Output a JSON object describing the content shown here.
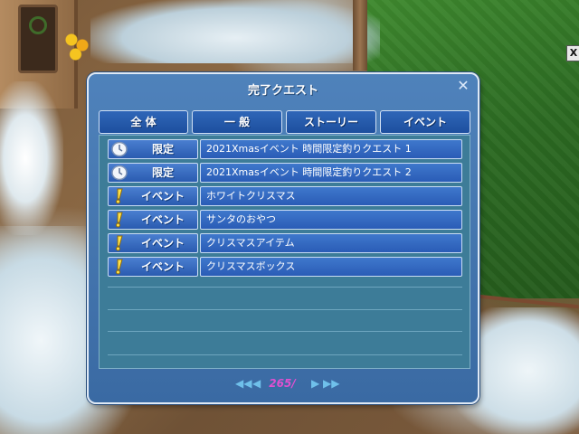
{
  "window": {
    "title": "完了クエスト",
    "close_glyph": "✕"
  },
  "side_button": {
    "glyph": "X"
  },
  "tabs": [
    {
      "label": "全 体"
    },
    {
      "label": "一 般"
    },
    {
      "label": "ストーリー"
    },
    {
      "label": "イベント"
    }
  ],
  "quests": [
    {
      "badge_icon": "clock-icon",
      "badge": "限定",
      "name": "2021Xmasイベント 時間限定釣りクエスト 1"
    },
    {
      "badge_icon": "clock-icon",
      "badge": "限定",
      "name": "2021Xmasイベント 時間限定釣りクエスト 2"
    },
    {
      "badge_icon": "exclamation-icon",
      "badge": "イベント",
      "name": "ホワイトクリスマス"
    },
    {
      "badge_icon": "exclamation-icon",
      "badge": "イベント",
      "name": "サンタのおやつ"
    },
    {
      "badge_icon": "exclamation-icon",
      "badge": "イベント",
      "name": "クリスマスアイテム"
    },
    {
      "badge_icon": "exclamation-icon",
      "badge": "イベント",
      "name": "クリスマスボックス"
    }
  ],
  "pager": {
    "first_glyph": "◀◀",
    "prev_glyph": "◀",
    "page": "265/",
    "next_glyph": "▶",
    "last_glyph": "▶▶"
  },
  "colors": {
    "dialog_bg": "#3a6aa3",
    "content_bg": "#3d7c98",
    "page_number": "#e050d0"
  }
}
